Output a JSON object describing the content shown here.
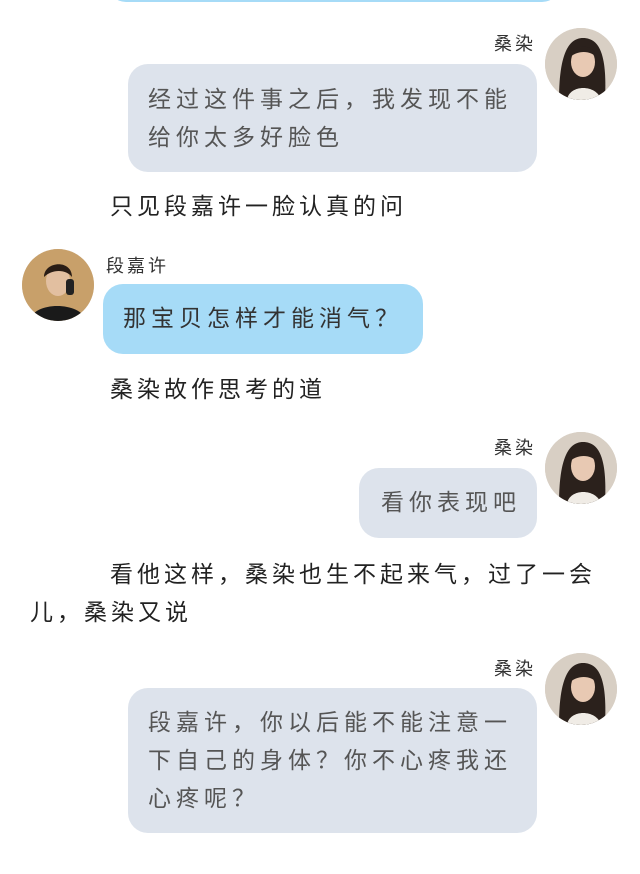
{
  "messages": [
    {
      "sender": "桑染",
      "text": "经过这件事之后，我发现不能给你太多好脸色"
    },
    {
      "narration": "只见段嘉许一脸认真的问"
    },
    {
      "sender": "段嘉许",
      "text": "那宝贝怎样才能消气？"
    },
    {
      "narration": "桑染故作思考的道"
    },
    {
      "sender": "桑染",
      "text": "看你表现吧"
    },
    {
      "narration": "看他这样，桑染也生不起来气，过了一会儿，桑染又说"
    },
    {
      "sender": "桑染",
      "text": "段嘉许，你以后能不能注意一下自己的身体？你不心疼我还心疼呢？"
    }
  ],
  "colors": {
    "left_bubble": "#a6dbf7",
    "right_bubble": "#dde3ec",
    "background": "#ffffff"
  }
}
